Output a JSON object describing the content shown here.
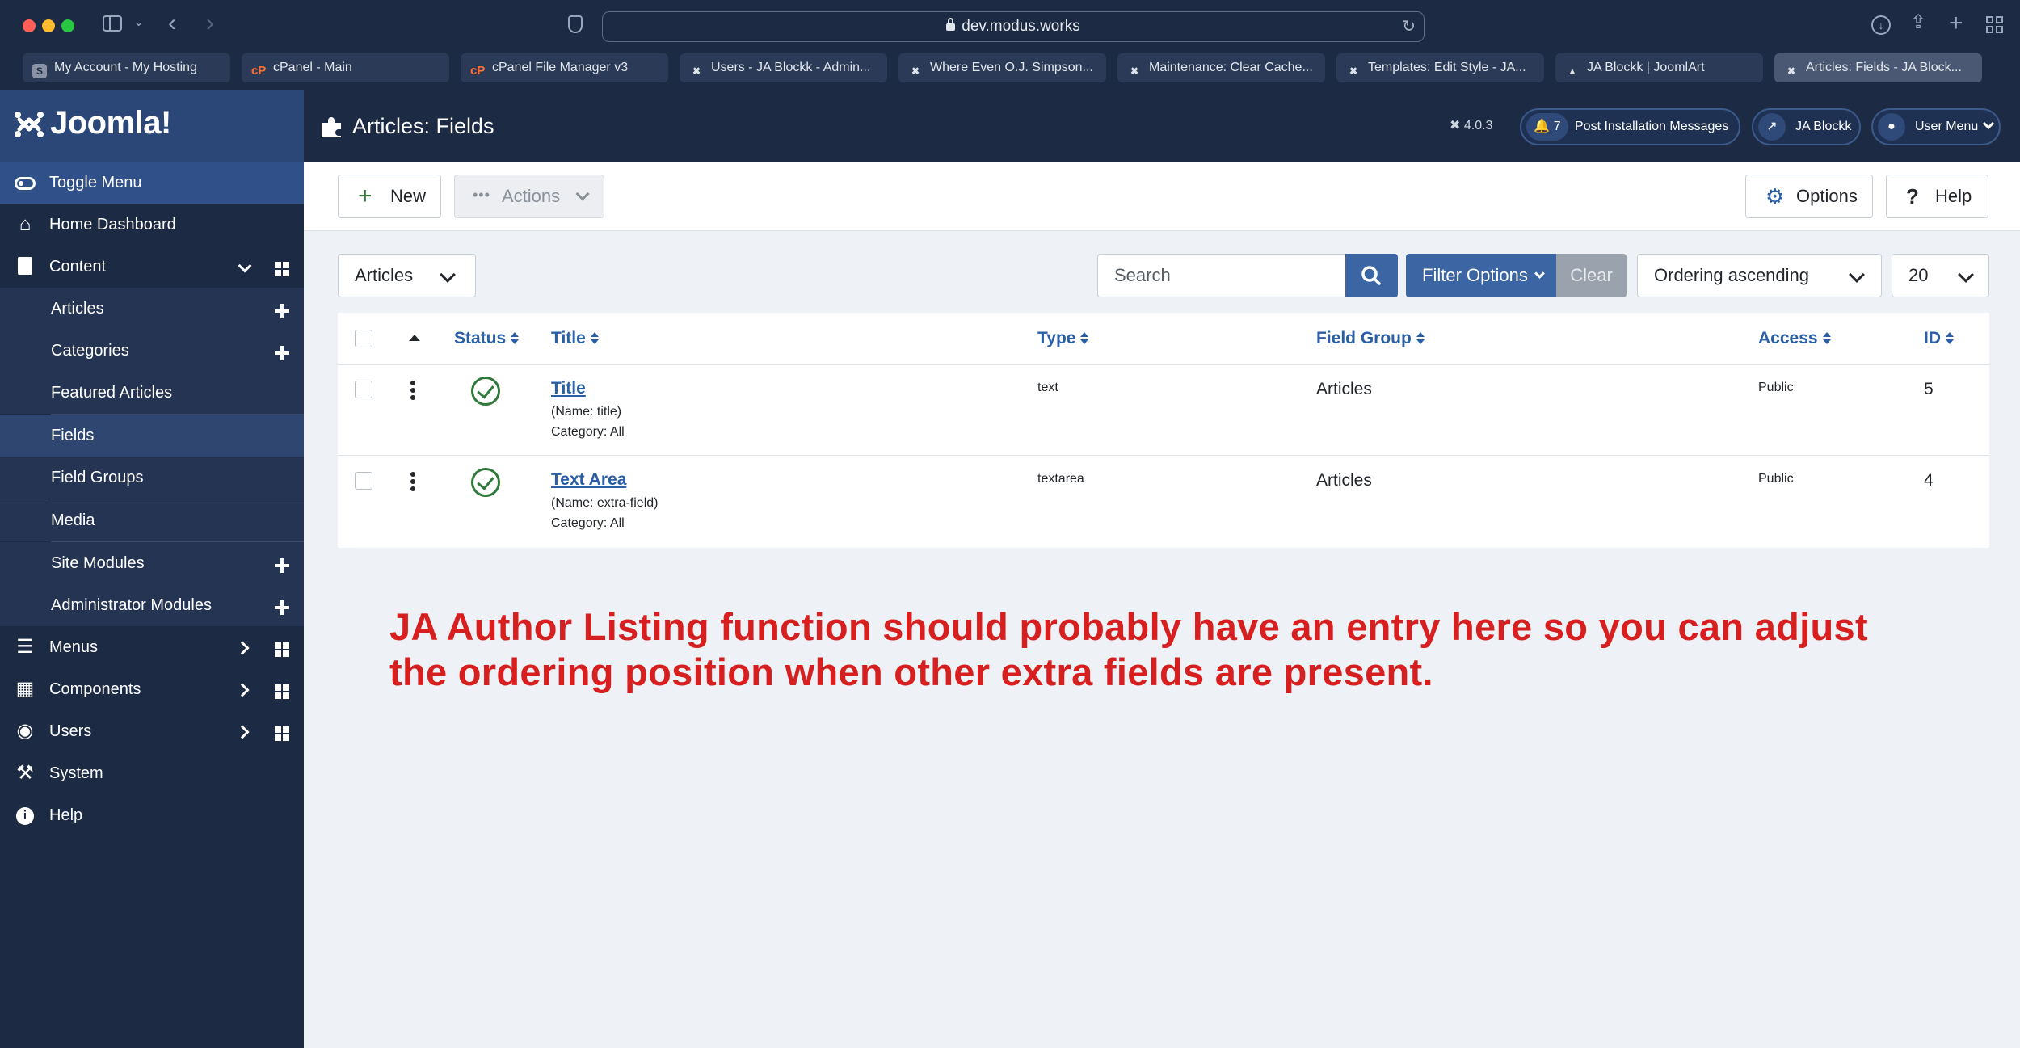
{
  "browser": {
    "url": "dev.modus.works",
    "tabs": [
      {
        "label": "My Account - My Hosting",
        "favicon": "s-icon",
        "active": false
      },
      {
        "label": "cPanel - Main",
        "favicon": "cpanel-icon",
        "active": false
      },
      {
        "label": "cPanel File Manager v3",
        "favicon": "cpanel-icon",
        "active": false
      },
      {
        "label": "Users - JA Blockk - Admin...",
        "favicon": "joomla-icon",
        "active": false
      },
      {
        "label": "Where Even O.J. Simpson...",
        "favicon": "joomla-icon",
        "active": false
      },
      {
        "label": "Maintenance: Clear Cache...",
        "favicon": "joomla-icon",
        "active": false
      },
      {
        "label": "Templates: Edit Style - JA...",
        "favicon": "joomla-icon",
        "active": false
      },
      {
        "label": "JA Blockk | JoomlArt",
        "favicon": "ja-icon",
        "active": false
      },
      {
        "label": "Articles: Fields - JA Block...",
        "favicon": "joomla-icon",
        "active": true
      }
    ]
  },
  "sidebar": {
    "logo_text": "Joomla!",
    "toggle_label": "Toggle Menu",
    "items": [
      {
        "label": "Home Dashboard",
        "icon": "home-icon"
      },
      {
        "label": "Content",
        "icon": "file-icon"
      },
      {
        "label": "Articles",
        "icon": ""
      },
      {
        "label": "Categories",
        "icon": ""
      },
      {
        "label": "Featured Articles",
        "icon": ""
      },
      {
        "label": "Fields",
        "icon": ""
      },
      {
        "label": "Field Groups",
        "icon": ""
      },
      {
        "label": "Media",
        "icon": ""
      },
      {
        "label": "Site Modules",
        "icon": ""
      },
      {
        "label": "Administrator Modules",
        "icon": ""
      },
      {
        "label": "Menus",
        "icon": "list-icon"
      },
      {
        "label": "Components",
        "icon": "puzzle-icon"
      },
      {
        "label": "Users",
        "icon": "users-icon"
      },
      {
        "label": "System",
        "icon": "wrench-icon"
      },
      {
        "label": "Help",
        "icon": "info-icon"
      }
    ]
  },
  "header": {
    "title": "Articles: Fields",
    "version": "4.0.3",
    "notifications_count": "7",
    "post_install_label": "Post Installation Messages",
    "site_label": "JA Blockk",
    "user_menu_label": "User Menu"
  },
  "toolbar": {
    "new_label": "New",
    "actions_label": "Actions",
    "options_label": "Options",
    "help_label": "Help"
  },
  "filters": {
    "context_value": "Articles",
    "search_placeholder": "Search",
    "filter_options_label": "Filter Options",
    "clear_label": "Clear",
    "ordering_value": "Ordering ascending",
    "limit_value": "20"
  },
  "table": {
    "columns": {
      "status": "Status",
      "title": "Title",
      "type": "Type",
      "field_group": "Field Group",
      "access": "Access",
      "id": "ID"
    },
    "rows": [
      {
        "title": "Title",
        "name": "(Name: title)",
        "category": "Category: All",
        "type": "text",
        "field_group": "Articles",
        "access": "Public",
        "id": "5"
      },
      {
        "title": "Text Area",
        "name": "(Name: extra-field)",
        "category": "Category: All",
        "type": "textarea",
        "field_group": "Articles",
        "access": "Public",
        "id": "4"
      }
    ]
  },
  "annotation": {
    "line1": "JA Author Listing function should probably have an entry here so you can adjust",
    "line2": "the ordering position when other extra fields are present."
  },
  "colors": {
    "sidebar_bg": "#1c2a44",
    "accent_blue": "#3b66a3",
    "link_blue": "#2a5fa5",
    "status_green": "#2f7a3a",
    "annotation_red": "#d71f1f"
  }
}
